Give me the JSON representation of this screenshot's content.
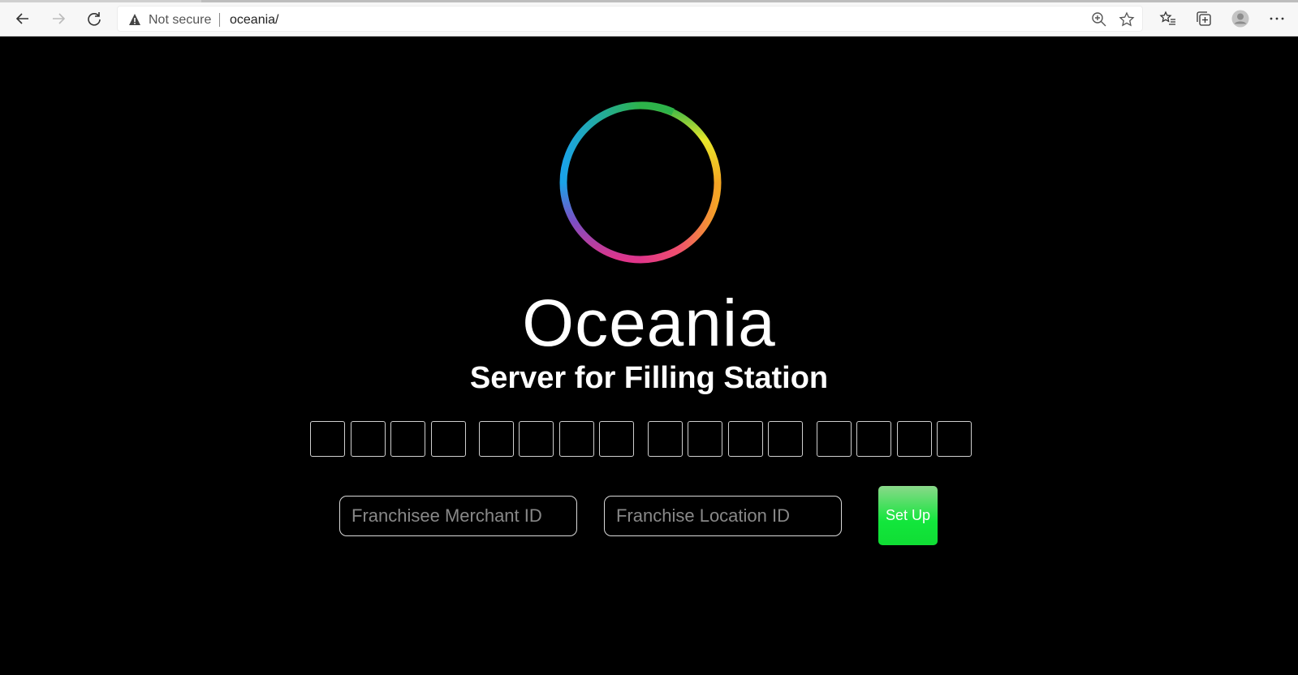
{
  "browser": {
    "security_label": "Not secure",
    "url": "oceania/",
    "icons": [
      "back-icon",
      "forward-icon",
      "refresh-icon",
      "warning-icon",
      "zoom-icon",
      "star-icon",
      "favorites-icon",
      "collections-icon",
      "profile-icon",
      "more-icon"
    ]
  },
  "page": {
    "title": "Oceania",
    "subtitle": "Server for Filling Station",
    "code_groups": 4,
    "boxes_per_group": 4,
    "merchant_placeholder": "Franchisee Merchant ID",
    "location_placeholder": "Franchise Location ID",
    "setup_label": "Set Up",
    "accent_green": "#12e63c"
  }
}
